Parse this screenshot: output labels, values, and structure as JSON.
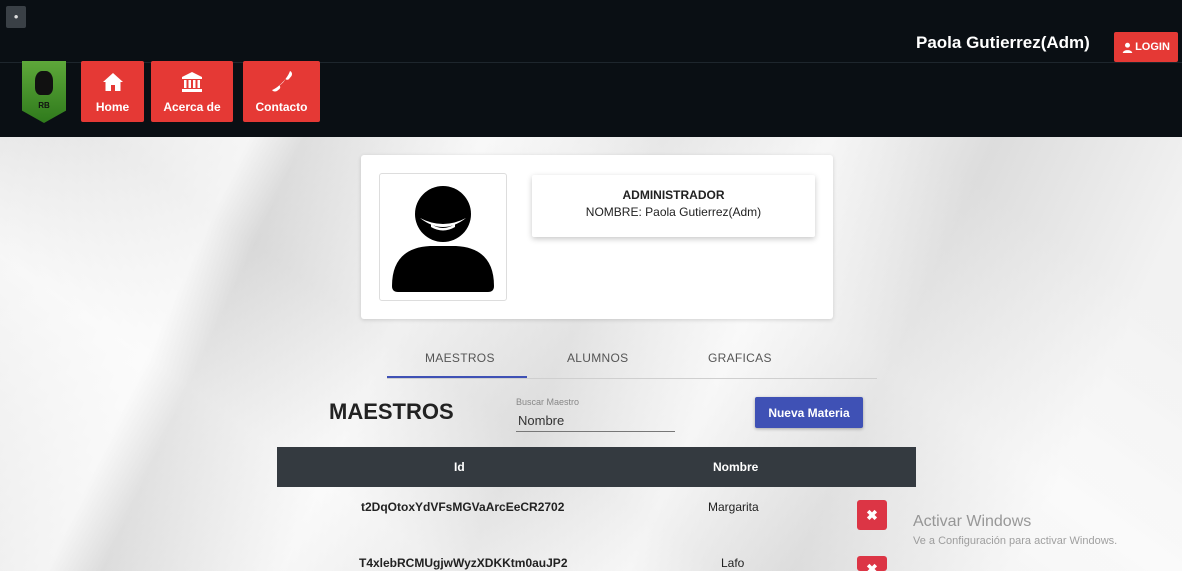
{
  "header": {
    "user_name": "Paola Gutierrez(Adm)",
    "login_label": "LOGIN",
    "logo_text": "RB",
    "nav": [
      {
        "label": "Home",
        "icon": "home-icon"
      },
      {
        "label": "Acerca de",
        "icon": "bank-icon"
      },
      {
        "label": "Contacto",
        "icon": "phone-icon"
      }
    ]
  },
  "profile": {
    "role": "ADMINISTRADOR",
    "name_line": "NOMBRE: Paola Gutierrez(Adm)",
    "avatar_icon": "user-avatar-icon"
  },
  "tabs": [
    "MAESTROS",
    "ALUMNOS",
    "GRAFICAS"
  ],
  "section": {
    "title": "MAESTROS",
    "search_label": "Buscar Maestro",
    "search_value": "Nombre",
    "new_button": "Nueva Materia"
  },
  "table": {
    "headers": [
      "Id",
      "Nombre"
    ],
    "rows": [
      {
        "id": "t2DqOtoxYdVFsMGVaArcEeCR2702",
        "nombre": "Margarita"
      },
      {
        "id": "T4xlebRCMUgjwWyzXDKKtm0auJP2",
        "nombre": "Lafo"
      }
    ]
  },
  "watermark": {
    "title": "Activar Windows",
    "subtitle": "Ve a Configuración para activar Windows."
  },
  "colors": {
    "header_bg": "#0a0f14",
    "nav_red": "#e53935",
    "primary_blue": "#3f51b5",
    "table_head": "#343a40",
    "delete_red": "#dc3545"
  }
}
